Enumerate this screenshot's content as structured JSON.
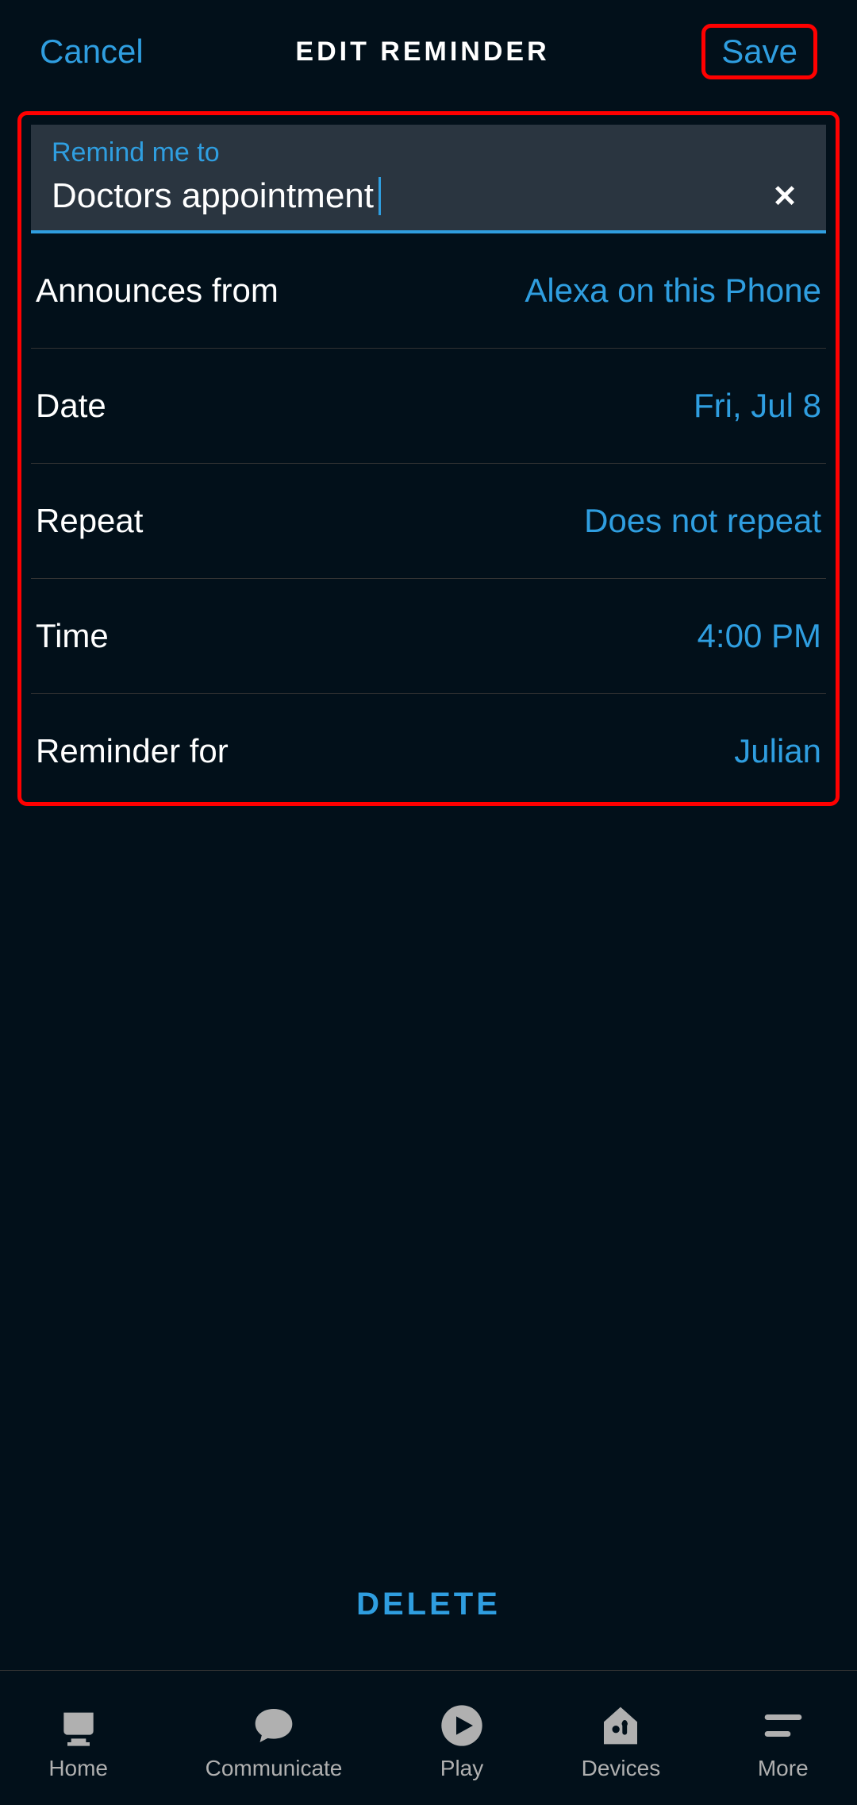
{
  "header": {
    "cancel": "Cancel",
    "title": "EDIT REMINDER",
    "save": "Save"
  },
  "input": {
    "label": "Remind me to",
    "value": "Doctors appointment"
  },
  "rows": {
    "announces": {
      "label": "Announces from",
      "value": "Alexa on this Phone"
    },
    "date": {
      "label": "Date",
      "value": "Fri, Jul 8"
    },
    "repeat": {
      "label": "Repeat",
      "value": "Does not repeat"
    },
    "time": {
      "label": "Time",
      "value": "4:00 PM"
    },
    "reminderfor": {
      "label": "Reminder for",
      "value": "Julian"
    }
  },
  "delete": "DELETE",
  "nav": {
    "home": "Home",
    "communicate": "Communicate",
    "play": "Play",
    "devices": "Devices",
    "more": "More"
  }
}
